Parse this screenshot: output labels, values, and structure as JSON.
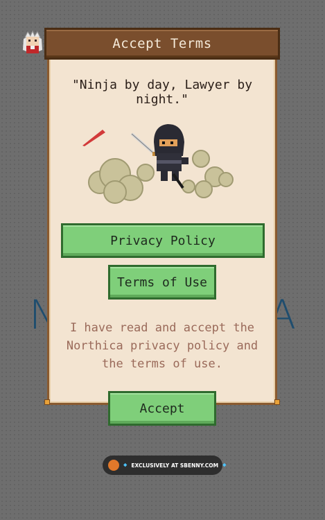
{
  "background_logo": {
    "left_letter": "N",
    "right_letter": "A"
  },
  "dialog": {
    "title": "Accept Terms",
    "quote": "\"Ninja by day, Lawyer by night.\"",
    "privacy_button": "Privacy Policy",
    "terms_button": "Terms of Use",
    "consent_text": "I have read and accept the Northica privacy policy and the terms of use.",
    "accept_button": "Accept"
  },
  "watermark": {
    "text": "EXCLUSIVELY AT SBENNY.COM"
  },
  "colors": {
    "title_bar": "#7a4e2d",
    "panel": "#f3e4d1",
    "button_green": "#7fcf7a",
    "consent_text": "#9a6a5a"
  }
}
